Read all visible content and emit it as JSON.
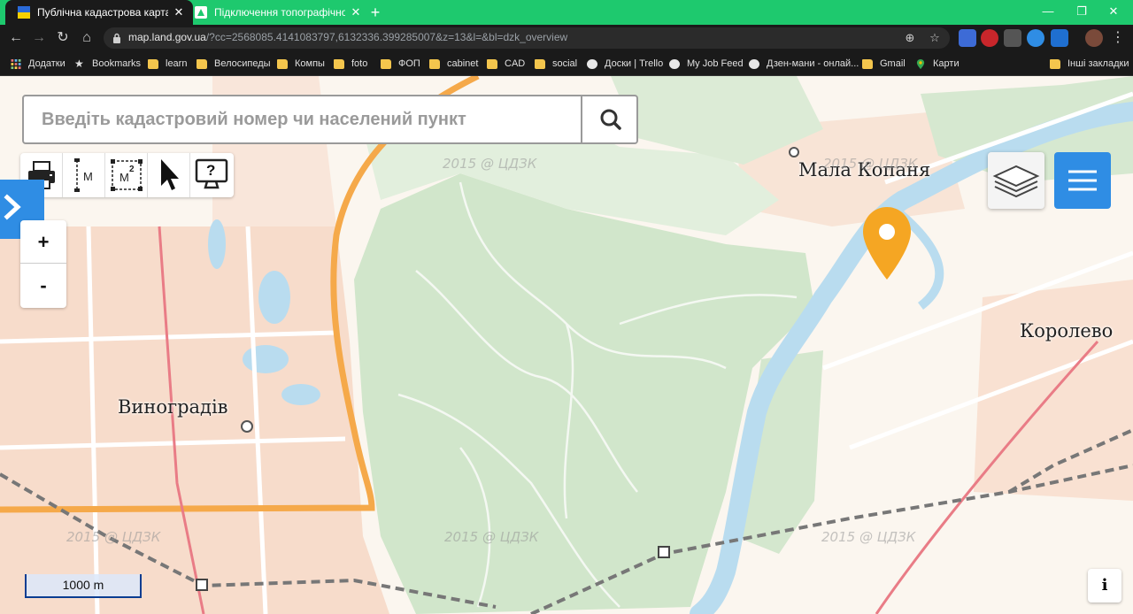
{
  "browser": {
    "tabs": [
      {
        "title": "Публічна кадастрова карта України",
        "active": true,
        "close": "✕"
      },
      {
        "title": "Підключення топографічної карти",
        "active": false,
        "close": "✕"
      }
    ],
    "new_tab": "+",
    "window_controls": {
      "minimize": "—",
      "maximize": "❐",
      "close": "✕"
    },
    "url_host": "map.land.gov.ua",
    "url_path": "/?cc=2568085.4141083797,6132336.399285007&z=13&l=&bl=dzk_overview",
    "bookmarks": [
      {
        "label": "Додатки",
        "icon": "apps-icon"
      },
      {
        "label": "Bookmarks",
        "icon": "star-icon"
      },
      {
        "label": "learn",
        "icon": "folder-icon"
      },
      {
        "label": "Велосипеды",
        "icon": "folder-icon"
      },
      {
        "label": "Компы",
        "icon": "folder-icon"
      },
      {
        "label": "foto",
        "icon": "folder-icon"
      },
      {
        "label": "ФОП",
        "icon": "folder-icon"
      },
      {
        "label": "cabinet",
        "icon": "folder-icon"
      },
      {
        "label": "CAD",
        "icon": "folder-icon"
      },
      {
        "label": "social",
        "icon": "folder-icon"
      },
      {
        "label": "Доски | Trello",
        "icon": "globe-icon"
      },
      {
        "label": "My Job Feed",
        "icon": "globe-icon"
      },
      {
        "label": "Дзен-мани - онлай...",
        "icon": "globe-icon"
      },
      {
        "label": "Gmail",
        "icon": "folder-icon"
      },
      {
        "label": "Карти",
        "icon": "maps-icon"
      }
    ],
    "other_bookmarks": "Інші закладки"
  },
  "map": {
    "search_placeholder": "Введіть кадастровий номер чи населений пункт",
    "tools": {
      "measure_distance": "M",
      "measure_area": "M",
      "measure_area_sup": "2",
      "info_q": "?"
    },
    "zoom_in": "+",
    "zoom_out": "-",
    "scale_label": "1000 m",
    "info_label": "i",
    "places": {
      "vynohradiv": "Виноградів",
      "mala_kopania": "Мала Копаня",
      "korolevo": "Королево"
    },
    "watermark": "2015 @ ЦДЗК",
    "colors": {
      "forest": "#cfe4c9",
      "urban": "#f7d8c4",
      "water": "#b9dcef",
      "accent": "#2f8de4",
      "marker": "#f5a623"
    }
  }
}
